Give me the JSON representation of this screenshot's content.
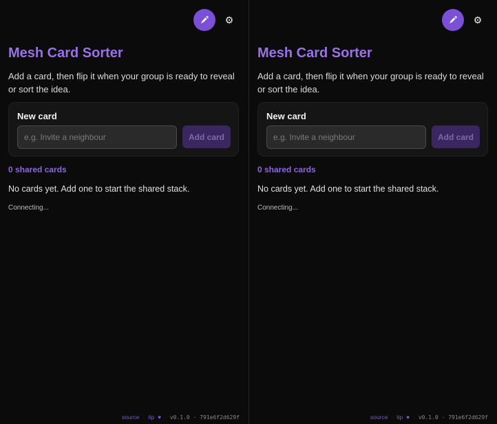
{
  "panes": [
    {
      "avatar_icon": "rocket-icon",
      "settings_icon": "gear-icon",
      "title": "Mesh Card Sorter",
      "subtitle": "Add a card, then flip it when your group is ready to reveal or sort the idea.",
      "new_card": {
        "label": "New card",
        "input_placeholder": "e.g. Invite a neighbour",
        "input_value": "",
        "button_label": "Add card"
      },
      "shared_count_label": "0 shared cards",
      "empty_message": "No cards yet. Add one to start the shared stack.",
      "status": "Connecting...",
      "footer": {
        "source_label": "source",
        "tip_label": "tip",
        "version": "v0.1.0 · 791e6f2d629f"
      }
    },
    {
      "avatar_icon": "rocket-icon",
      "settings_icon": "gear-icon",
      "title": "Mesh Card Sorter",
      "subtitle": "Add a card, then flip it when your group is ready to reveal or sort the idea.",
      "new_card": {
        "label": "New card",
        "input_placeholder": "e.g. Invite a neighbour",
        "input_value": "",
        "button_label": "Add card"
      },
      "shared_count_label": "0 shared cards",
      "empty_message": "No cards yet. Add one to start the shared stack.",
      "status": "Connecting...",
      "footer": {
        "source_label": "source",
        "tip_label": "tip",
        "version": "v0.1.0 · 791e6f2d629f"
      }
    }
  ],
  "colors": {
    "accent": "#9a72e8",
    "avatar_bg": "#7b4fd6",
    "button_bg": "#3a2760",
    "background": "#0b0b0b"
  }
}
